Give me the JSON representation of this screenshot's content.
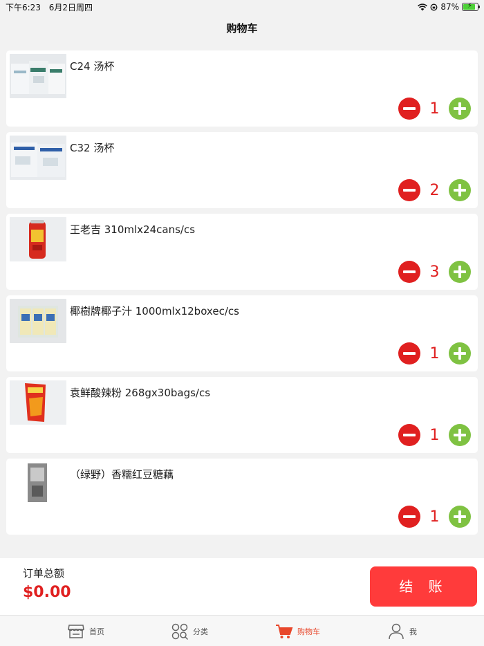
{
  "status_bar": {
    "time": "下午6:23",
    "date": "6月2日周四",
    "battery": "87%",
    "battery_level": 0.87
  },
  "header": {
    "title": "购物车"
  },
  "cart": {
    "items": [
      {
        "name": "C24 汤杯",
        "quantity": "1"
      },
      {
        "name": "C32 汤杯",
        "quantity": "2"
      },
      {
        "name": "王老吉 310mlx24cans/cs",
        "quantity": "3"
      },
      {
        "name": "椰樹牌椰子汁 1000mlx12boxec/cs",
        "quantity": "1"
      },
      {
        "name": "袁鲜酸辣粉 268gx30bags/cs",
        "quantity": "1"
      },
      {
        "name": "（绿野）香糯红豆糖藕",
        "quantity": "1"
      }
    ]
  },
  "order": {
    "total_label": "订单总额",
    "total_value": "$0.00",
    "checkout_label": "结 账"
  },
  "tabs": [
    {
      "label": "首页",
      "icon": "store-icon"
    },
    {
      "label": "分类",
      "icon": "category-search-icon"
    },
    {
      "label": "购物车",
      "icon": "cart-icon",
      "active": true
    },
    {
      "label": "我",
      "icon": "person-icon"
    }
  ],
  "colors": {
    "accent": "#e02020",
    "plus": "#7fc242",
    "checkout": "#ff3b3b",
    "active_tab": "#e8472b"
  }
}
